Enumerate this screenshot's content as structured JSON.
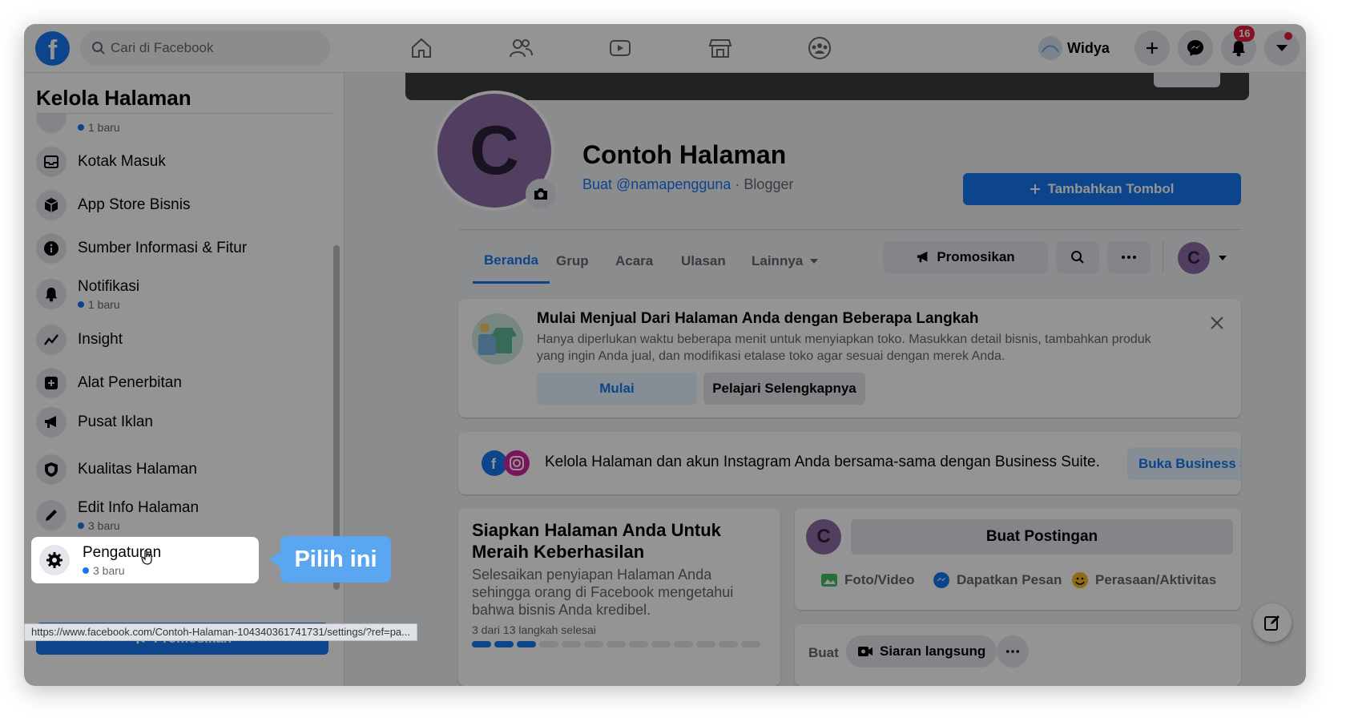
{
  "topbar": {
    "search_placeholder": "Cari di Facebook",
    "user_name": "Widya",
    "notification_count": "16"
  },
  "sidebar": {
    "title": "Kelola Halaman",
    "top_partial_sub": "1 baru",
    "items": [
      {
        "label": "Kotak Masuk",
        "sub": ""
      },
      {
        "label": "App Store Bisnis",
        "sub": ""
      },
      {
        "label": "Sumber Informasi & Fitur",
        "sub": ""
      },
      {
        "label": "Notifikasi",
        "sub": "1 baru"
      },
      {
        "label": "Insight",
        "sub": ""
      },
      {
        "label": "Alat Penerbitan",
        "sub": ""
      },
      {
        "label": "Pusat Iklan",
        "sub": ""
      },
      {
        "label": "Kualitas Halaman",
        "sub": ""
      },
      {
        "label": "Edit Info Halaman",
        "sub": "3 baru"
      },
      {
        "label": "Pengaturan",
        "sub": "3 baru"
      }
    ],
    "promote_label": "Promosikan"
  },
  "status_url": "https://www.facebook.com/Contoh-Halaman-104340361741731/settings/?ref=pa...",
  "page": {
    "avatar_letter": "C",
    "name": "Contoh Halaman",
    "username_link": "Buat @namapengguna",
    "separator": " · ",
    "category": "Blogger",
    "add_button": "Tambahkan Tombol",
    "tabs": [
      "Beranda",
      "Grup",
      "Acara",
      "Ulasan",
      "Lainnya"
    ],
    "promote_label": "Promosikan"
  },
  "shop_card": {
    "title": "Mulai Menjual Dari Halaman Anda dengan Beberapa Langkah",
    "text": "Hanya diperlukan waktu beberapa menit untuk menyiapkan toko. Masukkan detail bisnis, tambahkan produk yang ingin Anda jual, dan modifikasi etalase toko agar sesuai dengan merek Anda.",
    "start_label": "Mulai",
    "learn_label": "Pelajari Selengkapnya"
  },
  "suite_card": {
    "text": "Kelola Halaman dan akun Instagram Anda bersama-sama dengan Business Suite.",
    "button": "Buka Business Suite"
  },
  "setup_card": {
    "title": "Siapkan Halaman Anda Untuk Meraih Keberhasilan",
    "text": "Selesaikan penyiapan Halaman Anda sehingga orang di Facebook mengetahui bahwa bisnis Anda kredibel.",
    "progress_text": "3 dari 13 langkah selesai",
    "steps_done": 3,
    "steps_total": 13
  },
  "post_card": {
    "avatar_letter": "C",
    "create_post": "Buat Postingan",
    "actions": [
      "Foto/Video",
      "Dapatkan Pesan",
      "Perasaan/Aktivitas"
    ]
  },
  "live_card": {
    "label": "Buat",
    "live_button": "Siaran langsung"
  },
  "callout": "Pilih ini",
  "colors": {
    "brand": "#1877f2",
    "badge": "#e41e3f",
    "callout": "#5aa6f0"
  }
}
